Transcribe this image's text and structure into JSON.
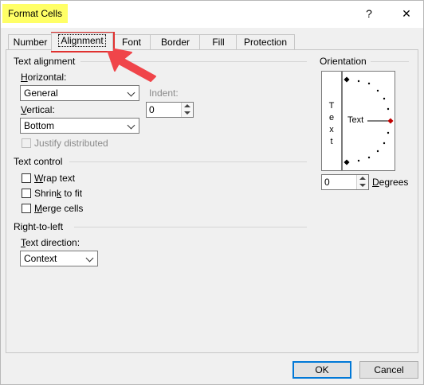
{
  "window": {
    "title": "Format Cells",
    "help_glyph": "?",
    "close_glyph": "✕"
  },
  "tabs": [
    {
      "label": "Number"
    },
    {
      "label": "Alignment"
    },
    {
      "label": "Font"
    },
    {
      "label": "Border"
    },
    {
      "label": "Fill"
    },
    {
      "label": "Protection"
    }
  ],
  "text_alignment": {
    "group_label": "Text alignment",
    "horizontal_label": "Horizontal:",
    "horizontal_value": "General",
    "vertical_label": "Vertical:",
    "vertical_value": "Bottom",
    "indent_label": "Indent:",
    "indent_value": "0",
    "justify_distributed_label": "Justify distributed"
  },
  "text_control": {
    "group_label": "Text control",
    "wrap_text_label": "Wrap text",
    "shrink_to_fit_label": "Shrink to fit",
    "merge_cells_label": "Merge cells"
  },
  "right_to_left": {
    "group_label": "Right-to-left",
    "text_direction_label": "Text direction:",
    "text_direction_value": "Context"
  },
  "orientation": {
    "group_label": "Orientation",
    "vertical_text": [
      "T",
      "e",
      "x",
      "t"
    ],
    "dial_text": "Text",
    "degrees_value": "0",
    "degrees_label": "Degrees"
  },
  "footer": {
    "ok_label": "OK",
    "cancel_label": "Cancel"
  },
  "annotation": {
    "highlight_color": "#e0312f",
    "title_highlight_color": "#ffff66"
  }
}
